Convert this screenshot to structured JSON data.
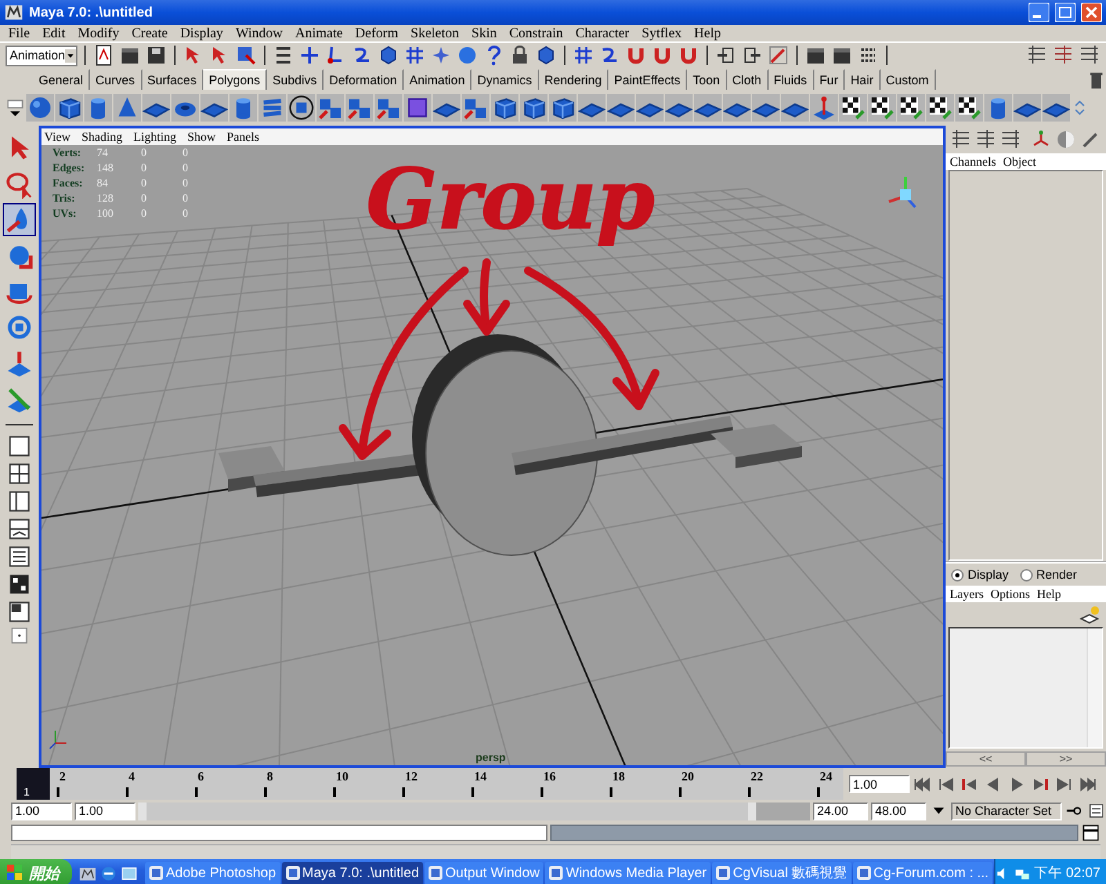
{
  "window": {
    "title": "Maya 7.0: .\\untitled"
  },
  "menu_bar": [
    "File",
    "Edit",
    "Modify",
    "Create",
    "Display",
    "Window",
    "Animate",
    "Deform",
    "Skeleton",
    "Skin",
    "Constrain",
    "Character",
    "Sytflex",
    "Help"
  ],
  "status_line": {
    "mode": "Animation"
  },
  "shelf_tabs": [
    {
      "label": "General",
      "selected": false
    },
    {
      "label": "Curves",
      "selected": false
    },
    {
      "label": "Surfaces",
      "selected": false
    },
    {
      "label": "Polygons",
      "selected": true
    },
    {
      "label": "Subdivs",
      "selected": false
    },
    {
      "label": "Deformation",
      "selected": false
    },
    {
      "label": "Animation",
      "selected": false
    },
    {
      "label": "Dynamics",
      "selected": false
    },
    {
      "label": "Rendering",
      "selected": false
    },
    {
      "label": "PaintEffects",
      "selected": false
    },
    {
      "label": "Toon",
      "selected": false
    },
    {
      "label": "Cloth",
      "selected": false
    },
    {
      "label": "Fluids",
      "selected": false
    },
    {
      "label": "Fur",
      "selected": false
    },
    {
      "label": "Hair",
      "selected": false
    },
    {
      "label": "Custom",
      "selected": false
    }
  ],
  "tools": [
    {
      "selected": false
    },
    {
      "selected": false
    },
    {
      "selected": true
    },
    {
      "selected": false
    },
    {
      "selected": false
    },
    {
      "selected": false
    },
    {
      "selected": false
    },
    {
      "selected": false
    }
  ],
  "viewport": {
    "menu": [
      "View",
      "Shading",
      "Lighting",
      "Show",
      "Panels"
    ],
    "hud": [
      {
        "label": "Verts:",
        "values": [
          "74",
          "0",
          "0"
        ]
      },
      {
        "label": "Edges:",
        "values": [
          "148",
          "0",
          "0"
        ]
      },
      {
        "label": "Faces:",
        "values": [
          "84",
          "0",
          "0"
        ]
      },
      {
        "label": "Tris:",
        "values": [
          "128",
          "0",
          "0"
        ]
      },
      {
        "label": "UVs:",
        "values": [
          "100",
          "0",
          "0"
        ]
      }
    ],
    "annotation": "Group",
    "camera": "persp"
  },
  "channel_box": {
    "menu": [
      "Channels",
      "Object"
    ]
  },
  "layer_editor": {
    "modes": [
      {
        "label": "Display",
        "selected": true
      },
      {
        "label": "Render",
        "selected": false
      }
    ],
    "menu": [
      "Layers",
      "Options",
      "Help"
    ]
  },
  "panel_scroll": [
    "<<",
    ">>"
  ],
  "time_slider": {
    "level": 0,
    "current_frame": "1",
    "ticks": [
      "2",
      "4",
      "6",
      "8",
      "10",
      "12",
      "14",
      "16",
      "18",
      "20",
      "22",
      "24"
    ],
    "frame_field": "1.00"
  },
  "range_slider": {
    "level": 0.92,
    "start": "1.00",
    "playback_start": "1.00",
    "playback_end": "24.00",
    "end": "48.00",
    "character_set": "No Character Set"
  },
  "taskbar": {
    "start": "開始",
    "tasks": [
      {
        "label": "Adobe Photoshop",
        "selected": false
      },
      {
        "label": "Maya 7.0: .\\untitled",
        "selected": true
      },
      {
        "label": "Output Window",
        "selected": false
      },
      {
        "label": "Windows Media Player",
        "selected": false
      },
      {
        "label": "CgVisual 數碼視覺",
        "selected": false
      },
      {
        "label": "Cg-Forum.com : ...",
        "selected": false
      }
    ],
    "clock": "下午 02:07"
  }
}
